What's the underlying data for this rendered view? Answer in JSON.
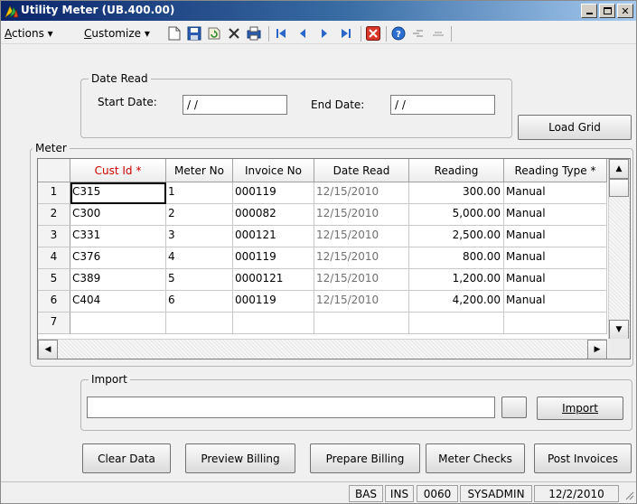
{
  "window": {
    "title": "Utility Meter (UB.400.00)",
    "buttons": [
      "minimize",
      "maximize",
      "close"
    ]
  },
  "toolbar": {
    "menus": [
      {
        "label": "Actions",
        "accel": "A"
      },
      {
        "label": "Customize",
        "accel": "C"
      }
    ],
    "icons": [
      "new-icon",
      "save-icon",
      "refresh-icon",
      "delete-icon",
      "print-icon",
      "first-record-icon",
      "previous-record-icon",
      "next-record-icon",
      "last-record-icon",
      "cancel-icon",
      "help-icon",
      "attach-icon",
      "note-icon"
    ]
  },
  "date_read": {
    "group_label": "Date Read",
    "start_label": "Start Date:",
    "start_value": "/ /",
    "end_label": "End Date:",
    "end_value": "/ /"
  },
  "load_grid_label": "Load Grid",
  "meter": {
    "group_label": "Meter",
    "columns": [
      "Cust Id *",
      "Meter No",
      "Invoice No",
      "Date Read",
      "Reading",
      "Reading Type *"
    ],
    "rows": [
      {
        "n": "1",
        "cust": "C315",
        "meter": "1",
        "invoice": "000119",
        "date": "12/15/2010",
        "reading": "300.00",
        "type": "Manual"
      },
      {
        "n": "2",
        "cust": "C300",
        "meter": "2",
        "invoice": "000082",
        "date": "12/15/2010",
        "reading": "5,000.00",
        "type": "Manual"
      },
      {
        "n": "3",
        "cust": "C331",
        "meter": "3",
        "invoice": "000121",
        "date": "12/15/2010",
        "reading": "2,500.00",
        "type": "Manual"
      },
      {
        "n": "4",
        "cust": "C376",
        "meter": "4",
        "invoice": "000119",
        "date": "12/15/2010",
        "reading": "800.00",
        "type": "Manual"
      },
      {
        "n": "5",
        "cust": "C389",
        "meter": "5",
        "invoice": "0000121",
        "date": "12/15/2010",
        "reading": "1,200.00",
        "type": "Manual"
      },
      {
        "n": "6",
        "cust": "C404",
        "meter": "6",
        "invoice": "000119",
        "date": "12/15/2010",
        "reading": "4,200.00",
        "type": "Manual"
      },
      {
        "n": "7",
        "cust": "",
        "meter": "",
        "invoice": "",
        "date": "",
        "reading": "",
        "type": ""
      }
    ]
  },
  "import": {
    "group_label": "Import",
    "path_value": "",
    "browse_label": "",
    "import_label": "Import"
  },
  "actions": {
    "clear_data": "Clear Data",
    "preview_billing": "Preview Billing",
    "prepare_billing": "Prepare Billing",
    "meter_checks": "Meter Checks",
    "post_invoices": "Post Invoices"
  },
  "status": {
    "panels": [
      "BAS",
      "INS",
      "0060",
      "SYSADMIN",
      "12/2/2010"
    ]
  },
  "colors": {
    "required_header": "#cc0000",
    "titlebar_start": "#0a246a",
    "titlebar_end": "#a6caf0"
  }
}
